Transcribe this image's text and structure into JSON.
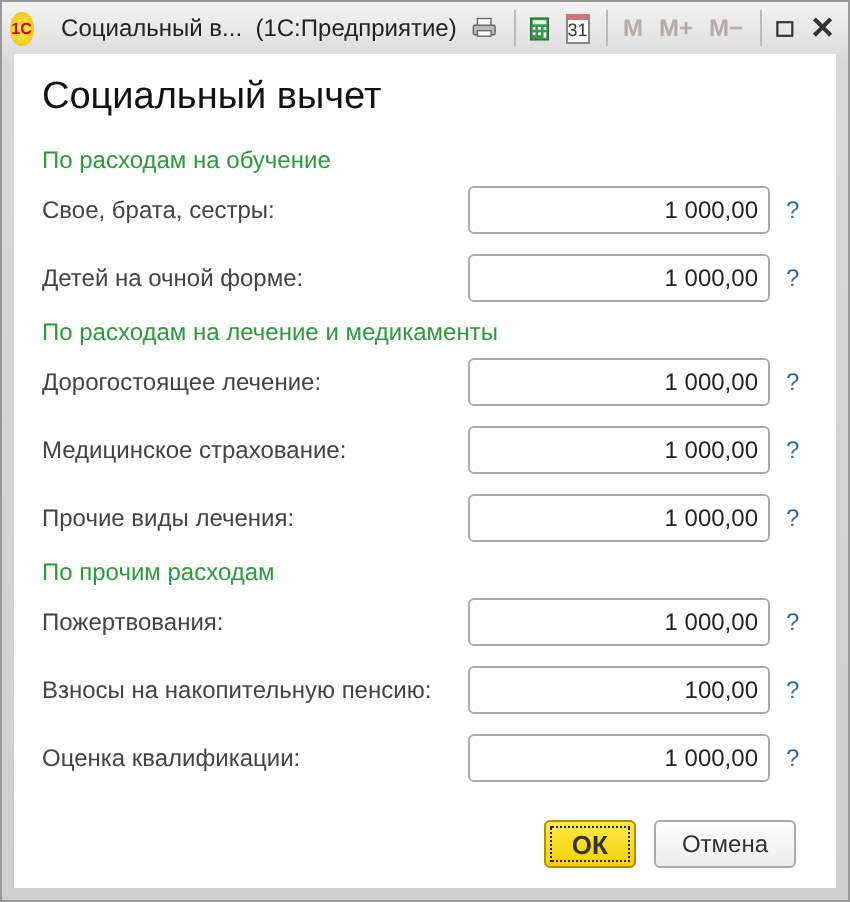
{
  "window": {
    "title": "Социальный в...  (1С:Предприятие)",
    "logo": "1С"
  },
  "toolbar": [
    {
      "kind": "printer"
    },
    {
      "kind": "calculator"
    },
    {
      "kind": "calendar",
      "text": "31"
    },
    {
      "kind": "memory",
      "text": "M",
      "disabled": true
    },
    {
      "kind": "memory",
      "text": "M+",
      "disabled": true
    },
    {
      "kind": "memory",
      "text": "M−",
      "disabled": true
    },
    {
      "kind": "maximize"
    },
    {
      "kind": "close",
      "text": "✕"
    }
  ],
  "heading": "Социальный вычет",
  "sections": [
    {
      "title": "По расходам на обучение",
      "rows": [
        {
          "label": "Свое, брата, сестры:",
          "value": "1 000,00",
          "help": "?"
        },
        {
          "label": "Детей на очной форме:",
          "value": "1 000,00",
          "help": "?"
        }
      ]
    },
    {
      "title": "По расходам на лечение и медикаменты",
      "rows": [
        {
          "label": "Дорогостоящее лечение:",
          "value": "1 000,00",
          "help": "?"
        },
        {
          "label": "Медицинское страхование:",
          "value": "1 000,00",
          "help": "?"
        },
        {
          "label": "Прочие виды лечения:",
          "value": "1 000,00",
          "help": "?"
        }
      ]
    },
    {
      "title": "По прочим расходам",
      "rows": [
        {
          "label": "Пожертвования:",
          "value": "1 000,00",
          "help": "?"
        },
        {
          "label": "Взносы на накопительную пенсию:",
          "value": "100,00",
          "help": "?"
        },
        {
          "label": "Оценка квалификации:",
          "value": "1 000,00",
          "help": "?"
        }
      ]
    }
  ],
  "buttons": [
    {
      "label": "ОК",
      "default": true
    },
    {
      "label": "Отмена",
      "default": false
    }
  ]
}
